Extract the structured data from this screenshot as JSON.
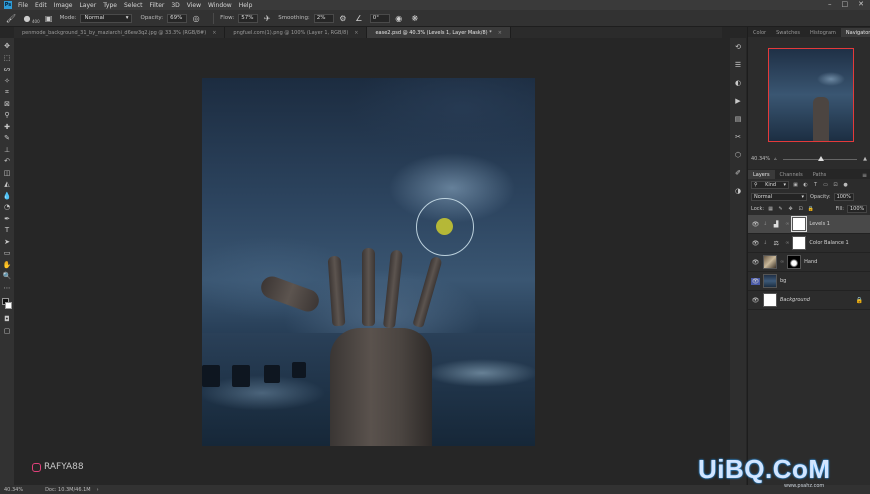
{
  "menu": {
    "app_logo": "Ps",
    "items": [
      "File",
      "Edit",
      "Image",
      "Layer",
      "Type",
      "Select",
      "Filter",
      "3D",
      "View",
      "Window",
      "Help"
    ]
  },
  "options": {
    "brush_size": "400",
    "mode_label": "Mode:",
    "mode_value": "Normal",
    "opacity_label": "Opacity:",
    "opacity_value": "69%",
    "flow_label": "Flow:",
    "flow_value": "57%",
    "smoothing_label": "Smoothing:",
    "smoothing_value": "2%",
    "angle_value": "0°"
  },
  "tabs": [
    {
      "label": "penmode_background_31_by_maziarchi_d6ew3q2.jpg @ 33.3% (RGB/8#)",
      "active": false
    },
    {
      "label": "pngfuel.com(1).png @ 100% (Layer 1, RGB/8)",
      "active": false
    },
    {
      "label": "ease2.psd @ 40.3% (Levels 1, Layer Mask/8) *",
      "active": true
    }
  ],
  "watermark": {
    "handle": "RAFYA88"
  },
  "status": {
    "zoom": "40.34%",
    "doc": "Doc: 10.3M/46.1M"
  },
  "panels": {
    "top_tabs": [
      "Color",
      "Swatches",
      "Histogram",
      "Navigator"
    ],
    "active_top_tab": "Navigator",
    "nav_zoom": "40.34%",
    "layer_tabs": [
      "Layers",
      "Channels",
      "Paths"
    ],
    "active_layer_tab": "Layers",
    "kind_label": "Kind",
    "blend_mode": "Normal",
    "opacity_label": "Opacity:",
    "opacity_value": "100%",
    "lock_label": "Lock:",
    "fill_label": "Fill:",
    "fill_value": "100%"
  },
  "layers": [
    {
      "name": "Levels 1",
      "italic": false,
      "active": true
    },
    {
      "name": "Color Balance 1",
      "italic": false,
      "active": false
    },
    {
      "name": "Hand",
      "italic": false,
      "active": false
    },
    {
      "name": "bg",
      "italic": false,
      "active": false
    },
    {
      "name": "Background",
      "italic": true,
      "active": false
    }
  ],
  "site_watermark": {
    "logo": "UiBQ.CoM",
    "sub": "www.psahz.com"
  }
}
